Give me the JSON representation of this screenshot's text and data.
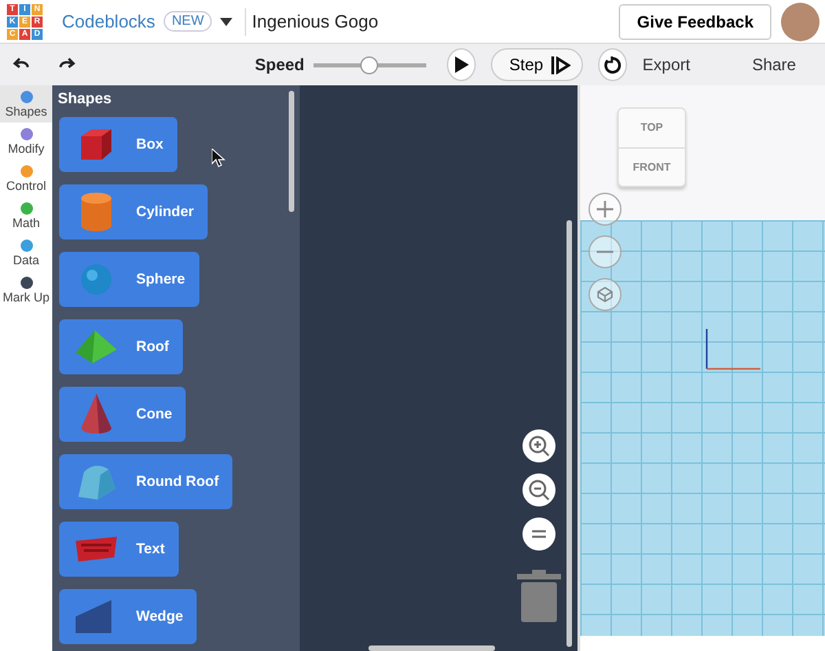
{
  "logo": {
    "rows": [
      [
        "T",
        "I",
        "N"
      ],
      [
        "K",
        "E",
        "R"
      ],
      [
        "C",
        "A",
        "D"
      ]
    ]
  },
  "header": {
    "app_name": "Codeblocks",
    "badge": "NEW",
    "design_name": "Ingenious Gogo",
    "feedback_button": "Give Feedback"
  },
  "toolbar": {
    "speed_label": "Speed",
    "speed": {
      "level": 0.5
    },
    "step_button": "Step",
    "export": "Export",
    "share": "Share"
  },
  "categories": [
    {
      "label": "Shapes",
      "color": "#4a8fe0",
      "selected": true
    },
    {
      "label": "Modify",
      "color": "#8c80d8",
      "selected": false
    },
    {
      "label": "Control",
      "color": "#f29a2e",
      "selected": false
    },
    {
      "label": "Math",
      "color": "#3cb44a",
      "selected": false
    },
    {
      "label": "Data",
      "color": "#3a9fdc",
      "selected": false
    },
    {
      "label": "Mark Up",
      "color": "#3c4858",
      "selected": false
    }
  ],
  "flyout": {
    "title": "Shapes",
    "blocks": [
      {
        "kind": "box",
        "label": "Box"
      },
      {
        "kind": "cylinder",
        "label": "Cylinder"
      },
      {
        "kind": "sphere",
        "label": "Sphere"
      },
      {
        "kind": "roof",
        "label": "Roof"
      },
      {
        "kind": "cone",
        "label": "Cone"
      },
      {
        "kind": "round_roof",
        "label": "Round Roof"
      },
      {
        "kind": "text",
        "label": "Text"
      },
      {
        "kind": "wedge",
        "label": "Wedge"
      }
    ]
  },
  "viewcube": {
    "top": "TOP",
    "front": "FRONT"
  }
}
